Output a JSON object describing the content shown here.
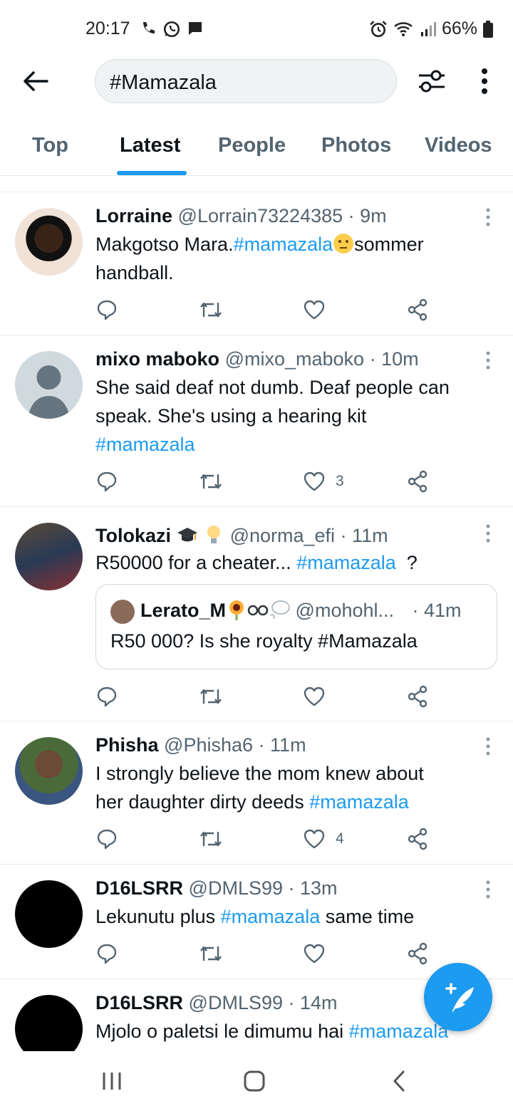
{
  "status": {
    "time": "20:17",
    "battery": "66%"
  },
  "search": {
    "query": "#Mamazala"
  },
  "tabs": [
    {
      "label": "Top"
    },
    {
      "label": "Latest"
    },
    {
      "label": "People"
    },
    {
      "label": "Photos"
    },
    {
      "label": "Videos"
    }
  ],
  "tweets": [
    {
      "name": "Lorraine",
      "handle": "@Lorrain73224385",
      "time": "· 9m",
      "t1": "Makgotso Mara.",
      "tag1": "#mamazala",
      "t2": "sommer",
      "t3": "handball.",
      "likes": ""
    },
    {
      "name": "mixo maboko",
      "handle": "@mixo_maboko",
      "time": "· 10m",
      "t1": "She said deaf not dumb. Deaf people can",
      "t2": "speak. She's using a hearing kit",
      "tag1": "#mamazala",
      "likes": "3"
    },
    {
      "name": "Tolokazi",
      "handle": "@norma_efi",
      "time": "· 11m",
      "t1": "R50000 for a cheater...",
      "tag1": "#mamazala",
      "t2": "?",
      "likes": "",
      "quote": {
        "name": "Lerato_M",
        "handle": "@mohohl...",
        "time": "· 41m",
        "text": "R50 000? Is she royalty #Mamazala"
      }
    },
    {
      "name": "Phisha",
      "handle": "@Phisha6",
      "time": "· 11m",
      "t1": "I strongly believe the mom knew about",
      "t2": "her daughter dirty deeds",
      "tag1": "#mamazala",
      "likes": "4"
    },
    {
      "name": "D16LSRR",
      "handle": "@DMLS99",
      "time": "· 13m",
      "t1": "Lekunutu plus",
      "tag1": "#mamazala",
      "t2": "same time",
      "likes": ""
    },
    {
      "name": "D16LSRR",
      "handle": "@DMLS99",
      "time": "· 14m",
      "t1": "Mjolo o paletsi le dimumu hai",
      "tag1": "#mamazala"
    }
  ],
  "colors": {
    "accent": "#1d9bf0",
    "text": "#0f1419",
    "secondary": "#536471"
  }
}
